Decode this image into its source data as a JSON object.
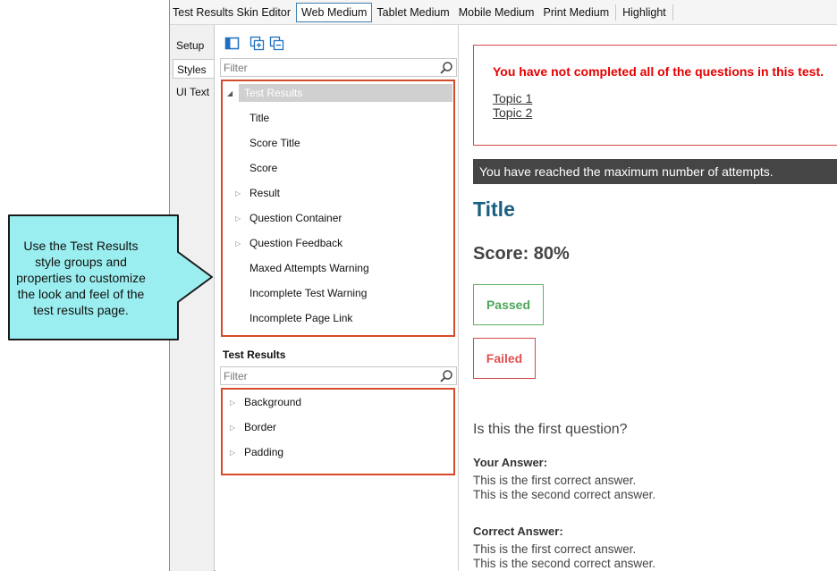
{
  "window": {
    "title": "Test Results Skin Editor",
    "tabs": [
      {
        "label": "Web Medium",
        "active": true
      },
      {
        "label": "Tablet Medium",
        "active": false
      },
      {
        "label": "Mobile Medium",
        "active": false
      },
      {
        "label": "Print Medium",
        "active": false
      },
      {
        "label": "Highlight",
        "active": false
      }
    ]
  },
  "side_tabs": [
    {
      "label": "Setup",
      "active": false
    },
    {
      "label": "Styles",
      "active": true
    },
    {
      "label": "UI Text",
      "active": false
    }
  ],
  "styles_panel": {
    "filter_placeholder": "Filter",
    "toolbar_icons": [
      "panel-toggle-icon",
      "add-style-icon",
      "copy-style-icon"
    ],
    "tree": [
      {
        "label": "Test Results",
        "selected": true,
        "expanded": true,
        "level": 0
      },
      {
        "label": "Title",
        "level": 1,
        "expandable": false
      },
      {
        "label": "Score Title",
        "level": 1,
        "expandable": false
      },
      {
        "label": "Score",
        "level": 1,
        "expandable": false
      },
      {
        "label": "Result",
        "level": 1,
        "expandable": true
      },
      {
        "label": "Question Container",
        "level": 1,
        "expandable": true
      },
      {
        "label": "Question Feedback",
        "level": 1,
        "expandable": true
      },
      {
        "label": "Maxed Attempts Warning",
        "level": 1,
        "expandable": false
      },
      {
        "label": "Incomplete Test Warning",
        "level": 1,
        "expandable": false
      },
      {
        "label": "Incomplete Page Link",
        "level": 1,
        "expandable": false
      }
    ]
  },
  "properties_panel": {
    "heading": "Test Results",
    "filter_placeholder": "Filter",
    "items": [
      {
        "label": "Background",
        "expandable": true
      },
      {
        "label": "Border",
        "expandable": true
      },
      {
        "label": "Padding",
        "expandable": true
      }
    ]
  },
  "preview": {
    "incomplete_message": "You have not completed all of the questions in this test.",
    "links": [
      "Topic 1",
      "Topic 2"
    ],
    "max_attempts_message": "You have reached the maximum number of attempts.",
    "title": "Title",
    "score": "Score: 80%",
    "passed_label": "Passed",
    "failed_label": "Failed",
    "question": "Is this the first question?",
    "your_answer_label": "Your Answer:",
    "your_answers": [
      "This is the first correct answer.",
      "This is the second correct answer."
    ],
    "correct_answer_label": "Correct Answer:",
    "correct_answers": [
      "This is the first correct answer.",
      "This is the second correct answer."
    ]
  },
  "callout": {
    "text": "Use the Test Results style groups and properties to customize the look and feel of the test results page."
  },
  "colors": {
    "highlight_border": "#d54a2a",
    "title_color": "#1b6080",
    "passed_color": "#4ea65a",
    "failed_color": "#e05050",
    "error_text": "#e60000",
    "callout_fill": "#9beeef",
    "warning_bar": "#454545"
  }
}
